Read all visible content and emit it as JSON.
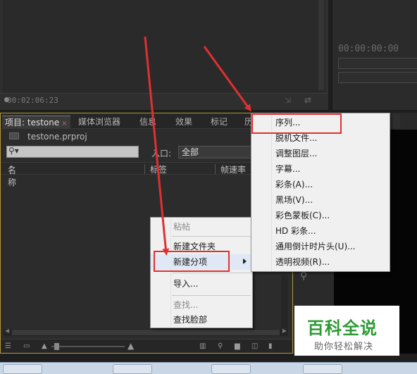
{
  "monitor_left": {
    "timecode": "00:02:06:23"
  },
  "monitor_right": {
    "timecode": "00:00:00:00"
  },
  "tabs": [
    {
      "label": "项目: testone",
      "active": true,
      "close": "×"
    },
    {
      "label": "媒体浏览器"
    },
    {
      "label": "信息"
    },
    {
      "label": "效果"
    },
    {
      "label": "标记"
    },
    {
      "label": "历"
    }
  ],
  "project": {
    "filename": "testone.prproj",
    "search_icon": "▾",
    "entry_label": "入口:",
    "entry_value": "全部",
    "columns": {
      "name": "名称",
      "tag": "标签",
      "framerate": "帧速率"
    }
  },
  "context_menu": {
    "items": [
      {
        "label": "粘帖",
        "disabled": true
      },
      {
        "label": "新建文件夹"
      },
      {
        "label": "新建分项",
        "submenu": true
      },
      {
        "label": "导入..."
      },
      {
        "label": "查找...",
        "disabled": true
      },
      {
        "label": "查找脸部"
      }
    ]
  },
  "submenu": {
    "items": [
      {
        "label": "序列..."
      },
      {
        "label": "脱机文件..."
      },
      {
        "label": "调整图层..."
      },
      {
        "label": "字幕..."
      },
      {
        "label": "彩条(A)..."
      },
      {
        "label": "黑场(V)..."
      },
      {
        "label": "彩色蒙板(C)..."
      },
      {
        "label": "HD 彩条..."
      },
      {
        "label": "通用倒计时片头(U)..."
      },
      {
        "label": "透明视频(R)..."
      }
    ]
  },
  "watermark": {
    "title": "百科全说",
    "subtitle": "助你轻松解决"
  },
  "colors": {
    "highlight_red": "#e03030",
    "watermark_green": "#2d9a35",
    "panel_focus": "#b59a3a"
  }
}
